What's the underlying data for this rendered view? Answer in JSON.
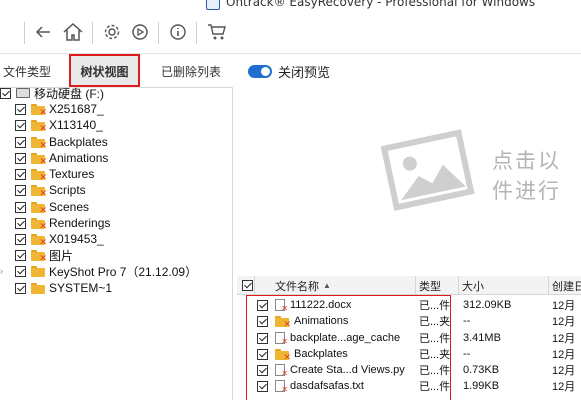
{
  "window": {
    "title": "Ontrack® EasyRecovery - Professional for Windows"
  },
  "toolbar": {
    "icons": [
      "back-icon",
      "home-icon",
      "gear-icon",
      "scan-icon",
      "info-icon",
      "cart-icon"
    ]
  },
  "left_tabs": [
    {
      "label": "文件类型",
      "active": false
    },
    {
      "label": "树状视图",
      "active": true
    },
    {
      "label": "已删除列表",
      "active": false
    }
  ],
  "tree": {
    "root": {
      "label": "移动硬盘 (F:)"
    },
    "items": [
      {
        "label": "X251687_",
        "deleted": true
      },
      {
        "label": "X113140_",
        "deleted": true
      },
      {
        "label": "Backplates",
        "deleted": true
      },
      {
        "label": "Animations",
        "deleted": true
      },
      {
        "label": "Textures",
        "deleted": true
      },
      {
        "label": "Scripts",
        "deleted": true
      },
      {
        "label": "Scenes",
        "deleted": true
      },
      {
        "label": "Renderings",
        "deleted": true
      },
      {
        "label": "X019453_",
        "deleted": true
      },
      {
        "label": "图片",
        "deleted": true
      },
      {
        "label": "KeyShot Pro 7（21.12.09）",
        "deleted": false,
        "expandable": true
      },
      {
        "label": "SYSTEM~1",
        "deleted": false
      }
    ]
  },
  "preview": {
    "toggle_label": "关闭预览",
    "toggle_on": true,
    "hint_line1": "点击以",
    "hint_line2": "件进行"
  },
  "file_table": {
    "columns": [
      "文件名称",
      "类型",
      "大小",
      "创建日"
    ],
    "rows": [
      {
        "name": "111222.docx",
        "type": "已...件",
        "size": "312.09KB",
        "date": "12月",
        "kind": "file"
      },
      {
        "name": "Animations",
        "type": "已...夹",
        "size": "--",
        "date": "12月",
        "kind": "folder"
      },
      {
        "name": "backplate...age_cache",
        "type": "已...件",
        "size": "3.41MB",
        "date": "12月",
        "kind": "file"
      },
      {
        "name": "Backplates",
        "type": "已...夹",
        "size": "--",
        "date": "12月",
        "kind": "folder"
      },
      {
        "name": "Create Sta...d Views.py",
        "type": "已...件",
        "size": "0.73KB",
        "date": "12月",
        "kind": "file"
      },
      {
        "name": "dasdafsafas.txt",
        "type": "已...件",
        "size": "1.99KB",
        "date": "12月",
        "kind": "file"
      }
    ]
  },
  "colors": {
    "accent": "#1f6fd0",
    "highlight": "#e0191e",
    "folder": "#f0b532",
    "deleted_mark": "#e23b1e"
  }
}
